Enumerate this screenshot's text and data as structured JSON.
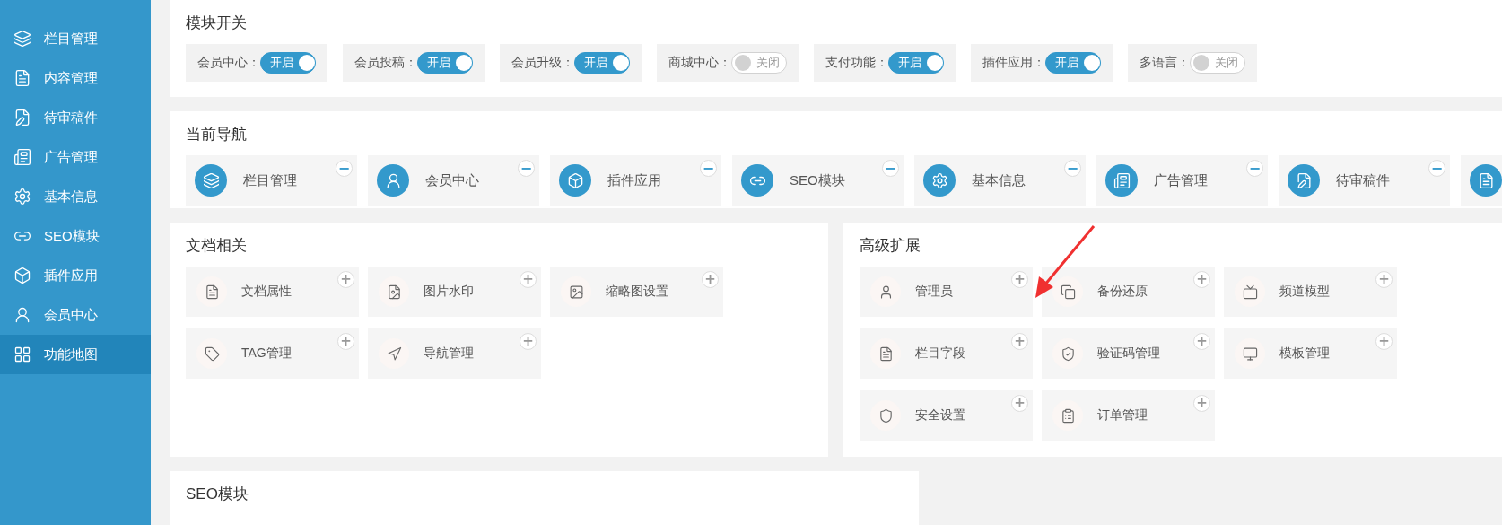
{
  "sidebar": {
    "items": [
      {
        "label": "栏目管理",
        "selected": false
      },
      {
        "label": "内容管理",
        "selected": false
      },
      {
        "label": "待审稿件",
        "selected": false
      },
      {
        "label": "广告管理",
        "selected": false
      },
      {
        "label": "基本信息",
        "selected": false
      },
      {
        "label": "SEO模块",
        "selected": false
      },
      {
        "label": "插件应用",
        "selected": false
      },
      {
        "label": "会员中心",
        "selected": false
      },
      {
        "label": "功能地图",
        "selected": true
      }
    ]
  },
  "module_switches": {
    "title": "模块开关",
    "items": [
      {
        "label": "会员中心：",
        "on": true,
        "state_text": "开启"
      },
      {
        "label": "会员投稿：",
        "on": true,
        "state_text": "开启"
      },
      {
        "label": "会员升级：",
        "on": true,
        "state_text": "开启"
      },
      {
        "label": "商城中心：",
        "on": false,
        "state_text": "关闭"
      },
      {
        "label": "支付功能：",
        "on": true,
        "state_text": "开启"
      },
      {
        "label": "插件应用：",
        "on": true,
        "state_text": "开启"
      },
      {
        "label": "多语言：",
        "on": false,
        "state_text": "关闭"
      }
    ]
  },
  "current_nav": {
    "title": "当前导航",
    "items": [
      {
        "kind": "full",
        "label": "栏目管理",
        "remove": "−"
      },
      {
        "kind": "full",
        "label": "会员中心",
        "remove": "−"
      },
      {
        "kind": "full",
        "label": "插件应用",
        "remove": "−"
      },
      {
        "kind": "full",
        "label": "SEO模块",
        "remove": "−"
      },
      {
        "kind": "full",
        "label": "基本信息",
        "remove": "−"
      },
      {
        "kind": "full",
        "label": "广告管理",
        "remove": "−"
      },
      {
        "kind": "full",
        "label": "待审稿件",
        "remove": "−"
      },
      {
        "kind": "partial"
      }
    ]
  },
  "document_panel": {
    "title": "文档相关",
    "items": [
      {
        "label": "文档属性",
        "add": "+"
      },
      {
        "label": "图片水印",
        "add": "+"
      },
      {
        "label": "缩略图设置",
        "add": "+"
      },
      {
        "label": "TAG管理",
        "add": "+"
      },
      {
        "label": "导航管理",
        "add": "+"
      }
    ]
  },
  "advanced_panel": {
    "title": "高级扩展",
    "items": [
      {
        "label": "管理员",
        "add": "+"
      },
      {
        "label": "备份还原",
        "add": "+"
      },
      {
        "label": "频道模型",
        "add": "+"
      },
      {
        "label": "栏目字段",
        "add": "+"
      },
      {
        "label": "验证码管理",
        "add": "+"
      },
      {
        "label": "模板管理",
        "add": "+"
      },
      {
        "label": "安全设置",
        "add": "+"
      },
      {
        "label": "订单管理",
        "add": "+"
      }
    ]
  },
  "seo_panel": {
    "title": "SEO模块"
  }
}
